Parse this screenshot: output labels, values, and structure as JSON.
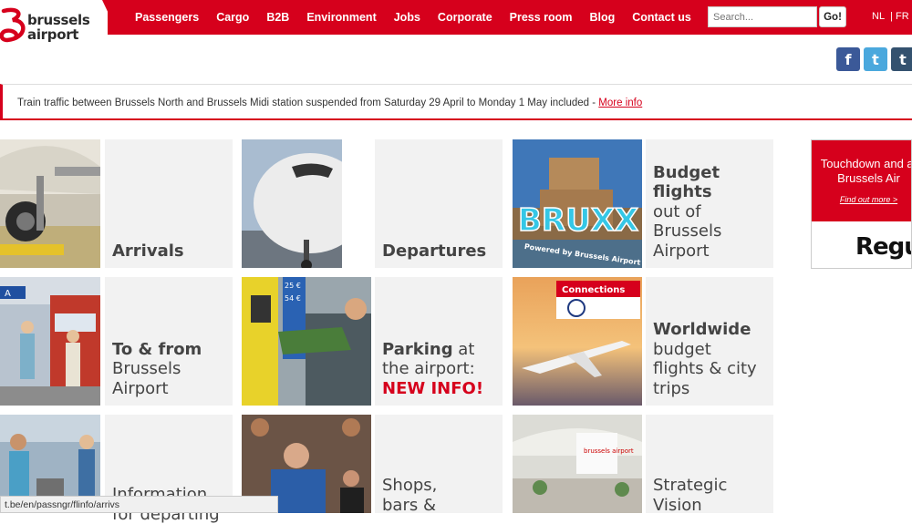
{
  "header": {
    "logo_line1": "brussels",
    "logo_line2": "airport",
    "nav": [
      "Passengers",
      "Cargo",
      "B2B",
      "Environment",
      "Jobs",
      "Corporate",
      "Press room",
      "Blog",
      "Contact us"
    ],
    "search_placeholder": "Search...",
    "search_button": "Go!",
    "lang_nl": "NL",
    "lang_fr": "| FR"
  },
  "social": [
    "f",
    "t",
    "t"
  ],
  "alert": {
    "text": "Train traffic between Brussels North and Brussels Midi station suspended from Saturday 29 April to Monday 1 May included - ",
    "link": "More info"
  },
  "tiles": {
    "arrivals": "Arrivals",
    "departures": "Departures",
    "budget_bold": "Budget flights",
    "budget_rest": "out of Brussels Airport",
    "to_from_bold": "To & from",
    "to_from_rest": "Brussels Airport",
    "parking_bold": "Parking",
    "parking_rest": " at the airport:",
    "parking_red": "NEW INFO!",
    "worldwide_bold": "Worldwide",
    "worldwide_rest": "budget flights & city trips",
    "info_departing": "Information for departing",
    "shops": "Shops, bars &",
    "strategic": "Strategic Vision"
  },
  "image_labels": {
    "bruxx": "BRUXX",
    "bruxx_sub": "Powered by Brussels Airport",
    "connections": "Connections",
    "screen_logo": "brussels airport",
    "sign": "A",
    "price1": "25 €",
    "price2": "54 €"
  },
  "ad": {
    "title": "Touchdown and at Brussels Air",
    "link": "Find out more >",
    "logo": "Regus"
  },
  "status_url": "t.be/en/passngr/flinfo/arrivs",
  "colors": {
    "brand_red": "#d6001c",
    "tile_bg": "#f2f2f2"
  }
}
